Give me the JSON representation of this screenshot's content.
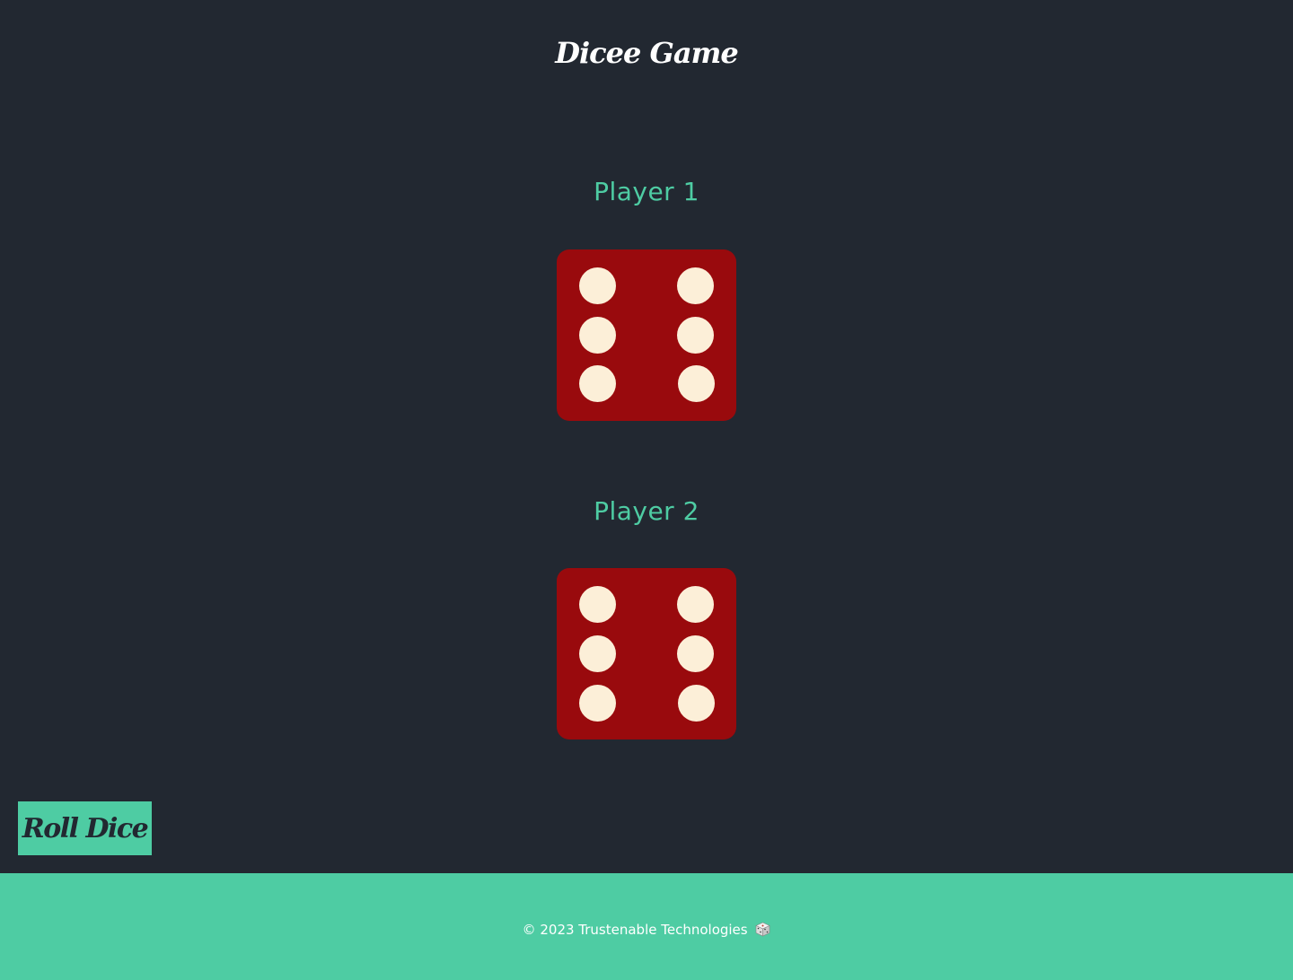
{
  "title": "Dicee Game",
  "players": [
    {
      "label": "Player 1",
      "die_value": 6
    },
    {
      "label": "Player 2",
      "die_value": 6
    }
  ],
  "roll_button_label": "Roll Dice",
  "footer": {
    "text": "© 2023 Trustenable Technologies",
    "icon": "dice-icon"
  },
  "colors": {
    "background": "#222831",
    "accent": "#4ecca3",
    "die": "#990a0d",
    "pip": "#fcefd8"
  }
}
